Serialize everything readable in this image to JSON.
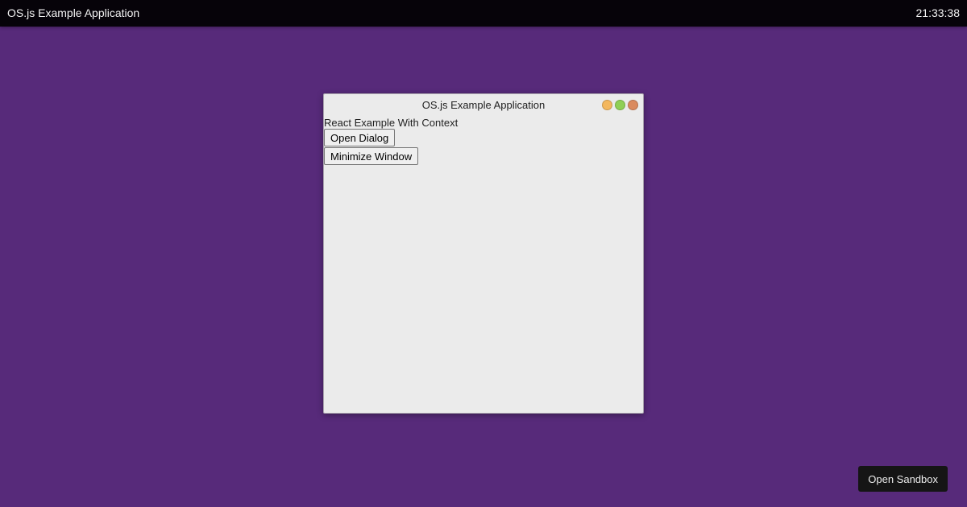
{
  "panel": {
    "title": "OS.js Example Application",
    "clock": "21:33:38"
  },
  "window": {
    "title": "OS.js Example Application",
    "content": {
      "heading": "React Example With Context",
      "open_dialog_label": "Open Dialog",
      "minimize_label": "Minimize Window"
    },
    "controls": {
      "minimize_color": "#f3b75e",
      "maximize_color": "#8fcf55",
      "close_color": "#da8a5e"
    }
  },
  "sandbox": {
    "label": "Open Sandbox"
  },
  "colors": {
    "desktop_background": "#572a7a",
    "panel_background": "#060309",
    "window_background": "#ebebeb"
  }
}
